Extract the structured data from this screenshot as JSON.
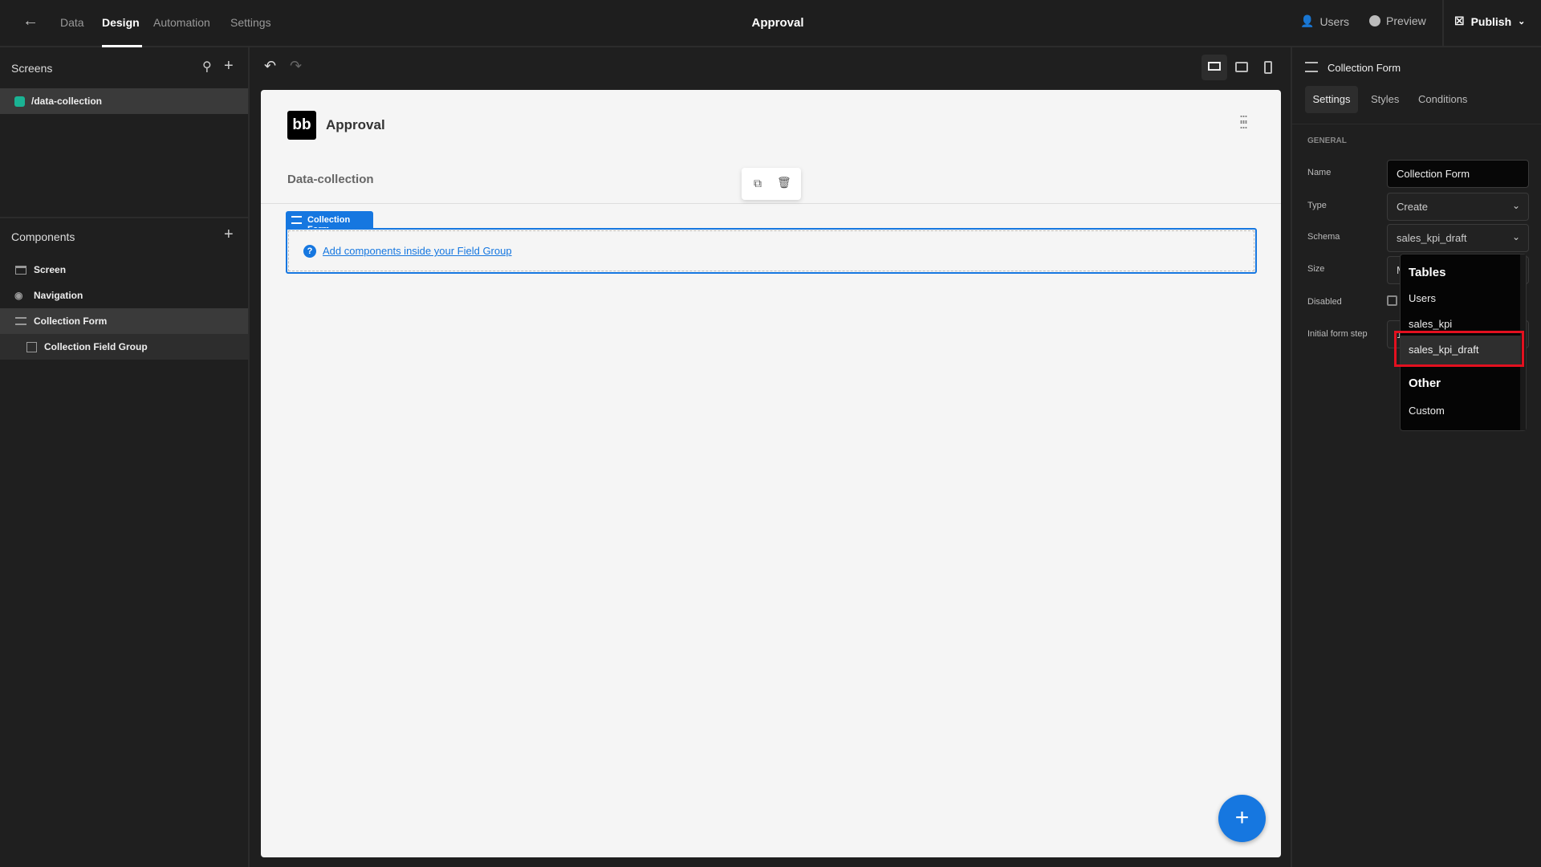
{
  "topbar": {
    "nav": [
      "Data",
      "Design",
      "Automation",
      "Settings"
    ],
    "title": "Approval",
    "users": "Users",
    "preview": "Preview",
    "publish": "Publish"
  },
  "screens": {
    "header": "Screens",
    "items": [
      {
        "label": "/data-collection",
        "color": "#1ab394"
      }
    ]
  },
  "components": {
    "header": "Components",
    "items": [
      "Screen",
      "Navigation",
      "Collection Form",
      "Collection Field Group"
    ]
  },
  "canvas": {
    "app_title": "Approval",
    "logo": "bb",
    "screen_title": "Data-collection",
    "form_tag": "Collection Form",
    "hint_link": "Add components inside your Field Group"
  },
  "settings": {
    "component_name": "Collection Form",
    "tabs": [
      "Settings",
      "Styles",
      "Conditions"
    ],
    "section": "GENERAL",
    "fields": {
      "name_label": "Name",
      "name_value": "Collection Form",
      "type_label": "Type",
      "type_value": "Create",
      "schema_label": "Schema",
      "schema_value": "sales_kpi_draft",
      "size_label": "Size",
      "size_value": "M",
      "disabled_label": "Disabled",
      "disabled_checked": false,
      "step_label": "Initial form step",
      "step_value": "1"
    }
  },
  "dropdown": {
    "group1": "Tables",
    "items1": [
      "Users",
      "sales_kpi",
      "sales_kpi_draft"
    ],
    "selected": "sales_kpi_draft",
    "group2": "Other",
    "items2": [
      "Custom"
    ]
  },
  "colors": {
    "accent": "#1677e0",
    "highlight": "#e3101f"
  }
}
